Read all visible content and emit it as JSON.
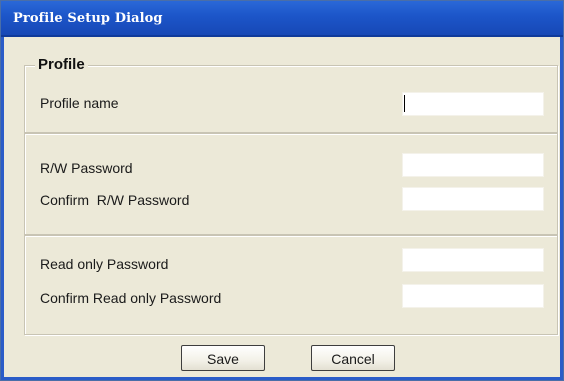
{
  "window": {
    "title": "Profile Setup Dialog"
  },
  "profile_group": {
    "legend": "Profile",
    "profile_name_label": "Profile name",
    "profile_name_value": ""
  },
  "rw_group": {
    "rw_password_label": "R/W Password",
    "rw_password_value": "",
    "confirm_rw_password_label": "Confirm  R/W Password",
    "confirm_rw_password_value": ""
  },
  "ro_group": {
    "ro_password_label": "Read only Password",
    "ro_password_value": "",
    "confirm_ro_password_label": "Confirm Read only Password",
    "confirm_ro_password_value": ""
  },
  "buttons": {
    "save_label": "Save",
    "cancel_label": "Cancel"
  },
  "colors": {
    "title_bar": "#1c55c8",
    "dialog_background": "#ece9d8",
    "field_background": "#ffffff"
  }
}
